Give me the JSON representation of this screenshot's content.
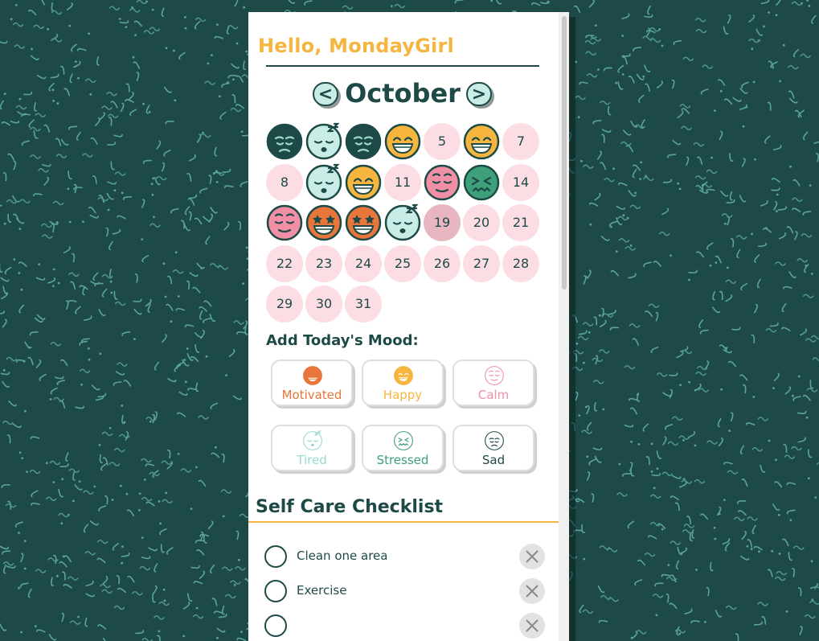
{
  "greeting": "Hello, MondayGirl",
  "calendar": {
    "month": "October",
    "prev_label": "<",
    "next_label": ">",
    "days": [
      {
        "day": 1,
        "mood": "sad"
      },
      {
        "day": 2,
        "mood": "tired"
      },
      {
        "day": 3,
        "mood": "sad"
      },
      {
        "day": 4,
        "mood": "happy"
      },
      {
        "day": 5,
        "label": "5"
      },
      {
        "day": 6,
        "mood": "happy"
      },
      {
        "day": 7,
        "label": "7"
      },
      {
        "day": 8,
        "label": "8"
      },
      {
        "day": 9,
        "mood": "tired"
      },
      {
        "day": 10,
        "mood": "happy"
      },
      {
        "day": 11,
        "label": "11"
      },
      {
        "day": 12,
        "mood": "calm"
      },
      {
        "day": 13,
        "mood": "stressed"
      },
      {
        "day": 14,
        "label": "14"
      },
      {
        "day": 15,
        "mood": "calm"
      },
      {
        "day": 16,
        "mood": "motivated"
      },
      {
        "day": 17,
        "mood": "motivated"
      },
      {
        "day": 18,
        "mood": "tired"
      },
      {
        "day": 19,
        "label": "19",
        "current": true
      },
      {
        "day": 20,
        "label": "20"
      },
      {
        "day": 21,
        "label": "21"
      },
      {
        "day": 22,
        "label": "22"
      },
      {
        "day": 23,
        "label": "23"
      },
      {
        "day": 24,
        "label": "24"
      },
      {
        "day": 25,
        "label": "25"
      },
      {
        "day": 26,
        "label": "26"
      },
      {
        "day": 27,
        "label": "27"
      },
      {
        "day": 28,
        "label": "28"
      },
      {
        "day": 29,
        "label": "29"
      },
      {
        "day": 30,
        "label": "30"
      },
      {
        "day": 31,
        "label": "31"
      }
    ]
  },
  "mood_heading": "Add Today's Mood:",
  "moods": [
    {
      "key": "motivated",
      "label": "Motivated",
      "color": "#e8763a"
    },
    {
      "key": "happy",
      "label": "Happy",
      "color": "#f5b53f"
    },
    {
      "key": "calm",
      "label": "Calm",
      "color": "#f08fa5"
    },
    {
      "key": "tired",
      "label": "Tired",
      "color": "#9ad8cd"
    },
    {
      "key": "stressed",
      "label": "Stressed",
      "color": "#3ea07a"
    },
    {
      "key": "sad",
      "label": "Sad",
      "color": "#1d4a47"
    }
  ],
  "checklist": {
    "heading": "Self Care Checklist",
    "items": [
      {
        "label": "Clean one area"
      },
      {
        "label": "Exercise"
      }
    ]
  },
  "colors": {
    "background": "#1d4a47",
    "accent": "#f5b53f",
    "day_cell": "#fcdde4",
    "current_day": "#e7b6c1"
  },
  "icons": {
    "prev": "chevron-left-icon",
    "next": "chevron-right-icon",
    "delete": "close-icon",
    "check": "circle-icon"
  }
}
